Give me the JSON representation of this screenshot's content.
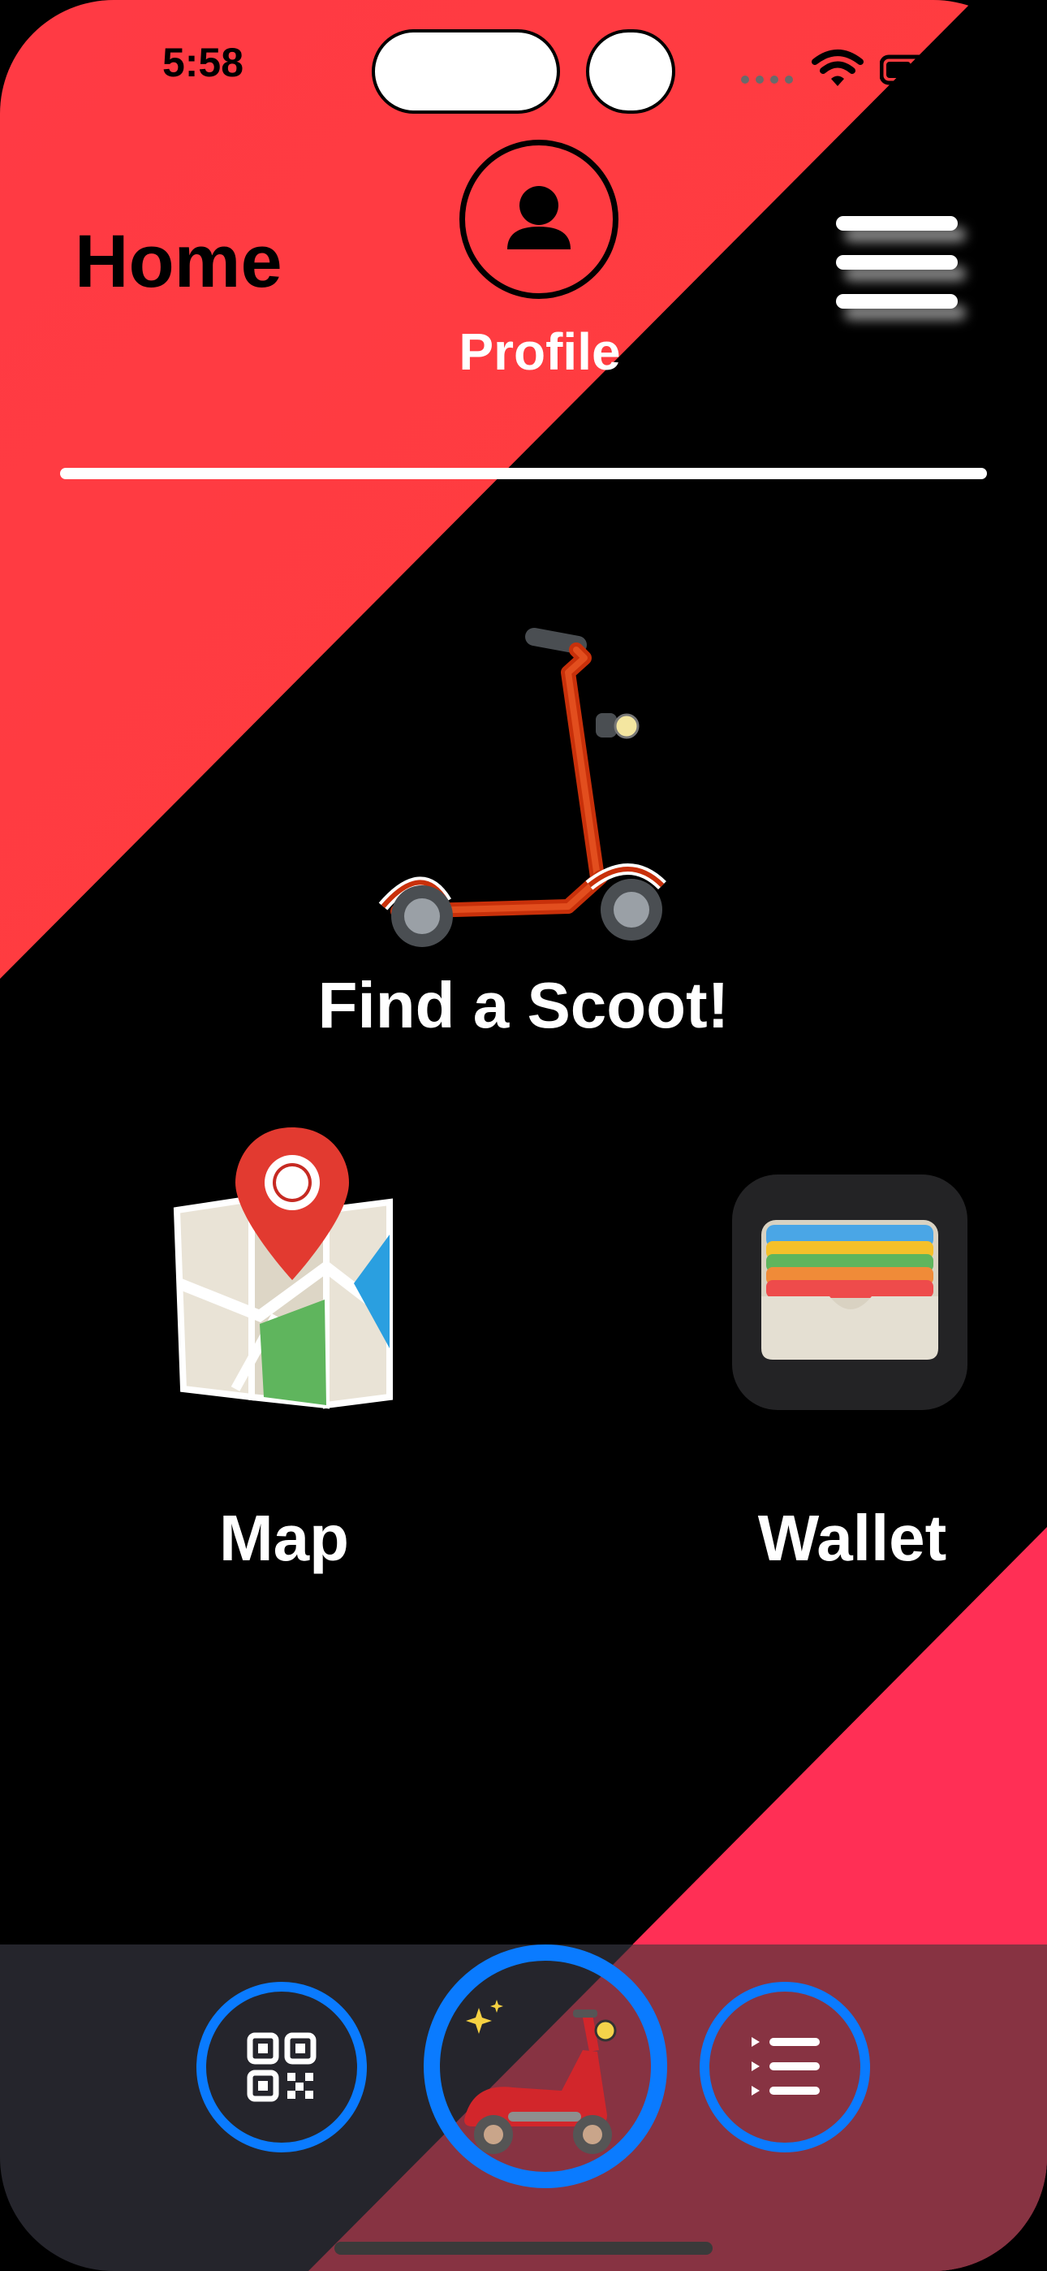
{
  "status_bar": {
    "time": "5:58"
  },
  "header": {
    "title": "Home",
    "profile_label": "Profile",
    "profile_icon": "person-circle-icon",
    "menu_icon": "hamburger-menu-icon"
  },
  "main": {
    "find_scoot": {
      "label": "Find a Scoot!",
      "icon": "kick-scooter-icon"
    },
    "map": {
      "label": "Map",
      "icon": "map-icon"
    },
    "wallet": {
      "label": "Wallet",
      "icon": "wallet-icon"
    }
  },
  "tab_bar": {
    "items": [
      {
        "name": "scan",
        "icon": "qr-code-icon"
      },
      {
        "name": "ride",
        "icon": "motor-scooter-icon"
      },
      {
        "name": "list",
        "icon": "list-icon"
      }
    ]
  },
  "colors": {
    "accent_red": "#ff3a44",
    "accent_pink": "#ff2f55",
    "tab_ring_blue": "#0a7bff",
    "background": "#000000"
  }
}
